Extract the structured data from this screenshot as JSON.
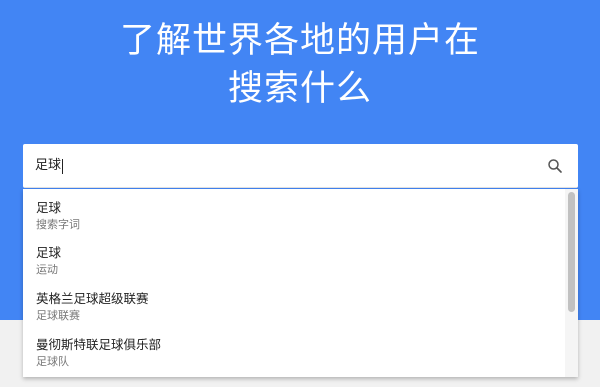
{
  "hero": {
    "title_line1": "了解世界各地的用户在",
    "title_line2": "搜索什么"
  },
  "search": {
    "value": "足球",
    "icon": "search-icon"
  },
  "suggestions": [
    {
      "title": "足球",
      "subtitle": "搜索字词"
    },
    {
      "title": "足球",
      "subtitle": "运动"
    },
    {
      "title": "英格兰足球超级联赛",
      "subtitle": "足球联赛"
    },
    {
      "title": "曼彻斯特联足球俱乐部",
      "subtitle": "足球队"
    }
  ],
  "colors": {
    "hero_bg": "#4285f4",
    "page_bg": "#f1f1f1"
  }
}
